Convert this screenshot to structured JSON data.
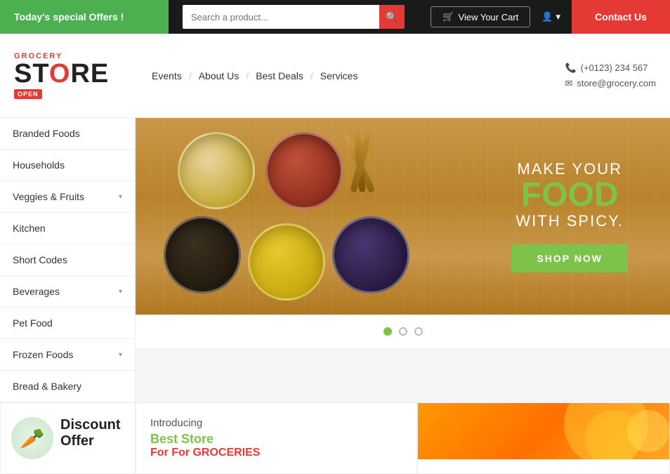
{
  "topbar": {
    "offer": "Today's special Offers !",
    "search_placeholder": "Search a product...",
    "cart": "View Your Cart",
    "contact": "Contact Us"
  },
  "header": {
    "logo_sub": "GROCERY",
    "logo_main_pre": "ST",
    "logo_main_color": "O",
    "logo_main_post": "RE",
    "logo_badge": "OPEN",
    "nav": [
      {
        "label": "Events"
      },
      {
        "label": "/"
      },
      {
        "label": "About Us"
      },
      {
        "label": "/"
      },
      {
        "label": "Best Deals"
      },
      {
        "label": "/"
      },
      {
        "label": "Services"
      }
    ],
    "phone": "(+0123) 234 567",
    "email": "store@grocery.com"
  },
  "sidebar": {
    "items": [
      {
        "label": "Branded Foods",
        "has_arrow": false
      },
      {
        "label": "Households",
        "has_arrow": false
      },
      {
        "label": "Veggies & Fruits",
        "has_arrow": true
      },
      {
        "label": "Kitchen",
        "has_arrow": false
      },
      {
        "label": "Short Codes",
        "has_arrow": false
      },
      {
        "label": "Beverages",
        "has_arrow": true
      },
      {
        "label": "Pet Food",
        "has_arrow": false
      },
      {
        "label": "Frozen Foods",
        "has_arrow": true
      },
      {
        "label": "Bread & Bakery",
        "has_arrow": false
      }
    ]
  },
  "hero": {
    "line1": "MAKE YOUR",
    "line2": "FOOD",
    "line3": "WITH SPICY.",
    "cta": "SHOP NOW"
  },
  "slider": {
    "dots": [
      {
        "active": true
      },
      {
        "active": false
      },
      {
        "active": false
      }
    ]
  },
  "bottom": {
    "discount_card": {
      "title": "Discount Offer"
    },
    "intro_card": {
      "line1": "Introducing",
      "line2": "Best Store",
      "line3": "For GROCERIES"
    }
  }
}
